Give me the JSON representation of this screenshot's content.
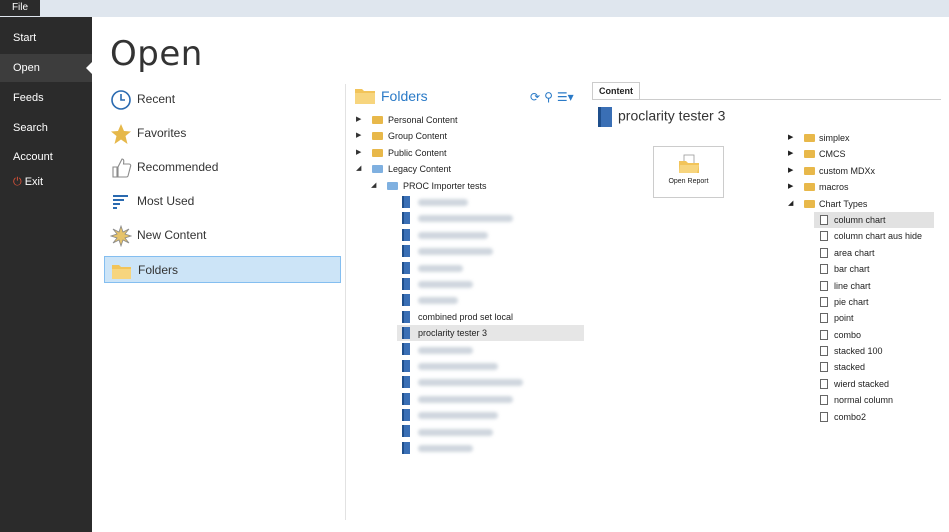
{
  "topbar": {
    "file_label": "File"
  },
  "nav": {
    "items": [
      "Start",
      "Open",
      "Feeds",
      "Search",
      "Account"
    ],
    "exit_label": "Exit"
  },
  "page_title": "Open",
  "locations": [
    "Recent",
    "Favorites",
    "Recommended",
    "Most Used",
    "New Content",
    "Folders"
  ],
  "folders": {
    "header": "Folders",
    "tree": [
      {
        "label": "Personal Content",
        "level": 0,
        "arrow": "▶",
        "icon": "folder"
      },
      {
        "label": "Group Content",
        "level": 0,
        "arrow": "▶",
        "icon": "folder"
      },
      {
        "label": "Public Content",
        "level": 0,
        "arrow": "▶",
        "icon": "folder"
      },
      {
        "label": "Legacy Content",
        "level": 0,
        "arrow": "◢",
        "icon": "folder-blue"
      },
      {
        "label": "PROC Importer tests",
        "level": 1,
        "arrow": "◢",
        "icon": "folder-blue"
      },
      {
        "label": "",
        "level": 2,
        "icon": "report",
        "blurred": true
      },
      {
        "label": "",
        "level": 2,
        "icon": "report",
        "blurred": true
      },
      {
        "label": "",
        "level": 2,
        "icon": "report",
        "blurred": true
      },
      {
        "label": "",
        "level": 2,
        "icon": "report",
        "blurred": true
      },
      {
        "label": "",
        "level": 2,
        "icon": "report",
        "blurred": true
      },
      {
        "label": "",
        "level": 2,
        "icon": "report",
        "blurred": true
      },
      {
        "label": "",
        "level": 2,
        "icon": "report",
        "blurred": true
      },
      {
        "label": "combined prod set local",
        "level": 2,
        "icon": "report"
      },
      {
        "label": "proclarity tester 3",
        "level": 2,
        "icon": "report",
        "selected": true
      },
      {
        "label": "",
        "level": 2,
        "icon": "report",
        "blurred": true
      },
      {
        "label": "",
        "level": 2,
        "icon": "report",
        "blurred": true
      },
      {
        "label": "",
        "level": 2,
        "icon": "report",
        "blurred": true
      },
      {
        "label": "",
        "level": 2,
        "icon": "report",
        "blurred": true
      },
      {
        "label": "",
        "level": 2,
        "icon": "report",
        "blurred": true
      },
      {
        "label": "",
        "level": 2,
        "icon": "report",
        "blurred": true
      },
      {
        "label": "",
        "level": 2,
        "icon": "report",
        "blurred": true
      }
    ]
  },
  "content": {
    "tab_label": "Content",
    "title": "proclarity tester 3",
    "open_report_label": "Open Report",
    "tree": [
      {
        "label": "simplex",
        "type": "folder",
        "arrow": "▶"
      },
      {
        "label": "CMCS",
        "type": "folder",
        "arrow": "▶"
      },
      {
        "label": "custom MDXx",
        "type": "folder",
        "arrow": "▶"
      },
      {
        "label": "macros",
        "type": "folder",
        "arrow": "▶"
      },
      {
        "label": "Chart Types",
        "type": "folder",
        "arrow": "◢"
      },
      {
        "label": "column chart",
        "type": "page",
        "selected": true
      },
      {
        "label": "column chart aus hide",
        "type": "page"
      },
      {
        "label": "area chart",
        "type": "page"
      },
      {
        "label": "bar chart",
        "type": "page"
      },
      {
        "label": "line chart",
        "type": "page"
      },
      {
        "label": "pie chart",
        "type": "page"
      },
      {
        "label": "point",
        "type": "page"
      },
      {
        "label": "combo",
        "type": "page"
      },
      {
        "label": "stacked 100",
        "type": "page"
      },
      {
        "label": "stacked",
        "type": "page"
      },
      {
        "label": "wierd stacked",
        "type": "page"
      },
      {
        "label": "normal column",
        "type": "page"
      },
      {
        "label": "combo2",
        "type": "page"
      }
    ]
  }
}
